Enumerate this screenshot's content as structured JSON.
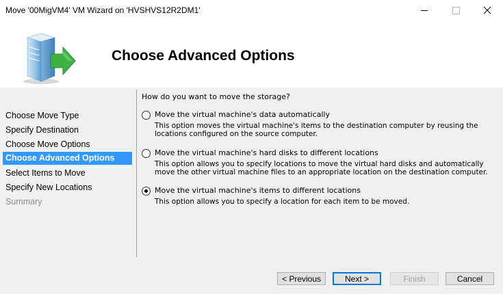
{
  "window": {
    "title": "Move '00MigVM4' VM Wizard on 'HVSHVS12R2DM1'",
    "minimize_glyph": "—",
    "maximize_glyph": "☐",
    "close_glyph": "✕"
  },
  "header": {
    "title": "Choose Advanced Options",
    "icon": "server-move-icon"
  },
  "nav": {
    "items": [
      {
        "label": "Choose Move Type",
        "state": "normal"
      },
      {
        "label": "Specify Destination",
        "state": "normal"
      },
      {
        "label": "Choose Move Options",
        "state": "normal"
      },
      {
        "label": "Choose Advanced Options",
        "state": "active"
      },
      {
        "label": "Select Items to Move",
        "state": "normal"
      },
      {
        "label": "Specify New Locations",
        "state": "normal"
      },
      {
        "label": "Summary",
        "state": "disabled"
      }
    ]
  },
  "main": {
    "question": "How do you want to move the storage?",
    "options": [
      {
        "label": "Move the virtual machine's data automatically",
        "description": "This option moves the virtual machine's items to the destination computer by reusing the locations configured on the source computer.",
        "checked": false
      },
      {
        "label": "Move the virtual machine's hard disks to different locations",
        "description": "This option allows you to specify locations to move the virtual hard disks and automatically move the other virtual machine files to an appropriate location on the destination computer.",
        "checked": false
      },
      {
        "label": "Move the virtual machine's items to different locations",
        "description": "This option allows you to specify a location for each item to be moved.",
        "checked": true
      }
    ]
  },
  "footer": {
    "previous_label": "< Previous",
    "next_label": "Next >",
    "finish_label": "Finish",
    "cancel_label": "Cancel"
  },
  "colors": {
    "selection": "#3399ff",
    "default_button_border": "#0078d7",
    "arrow_green": "#3cb043"
  }
}
